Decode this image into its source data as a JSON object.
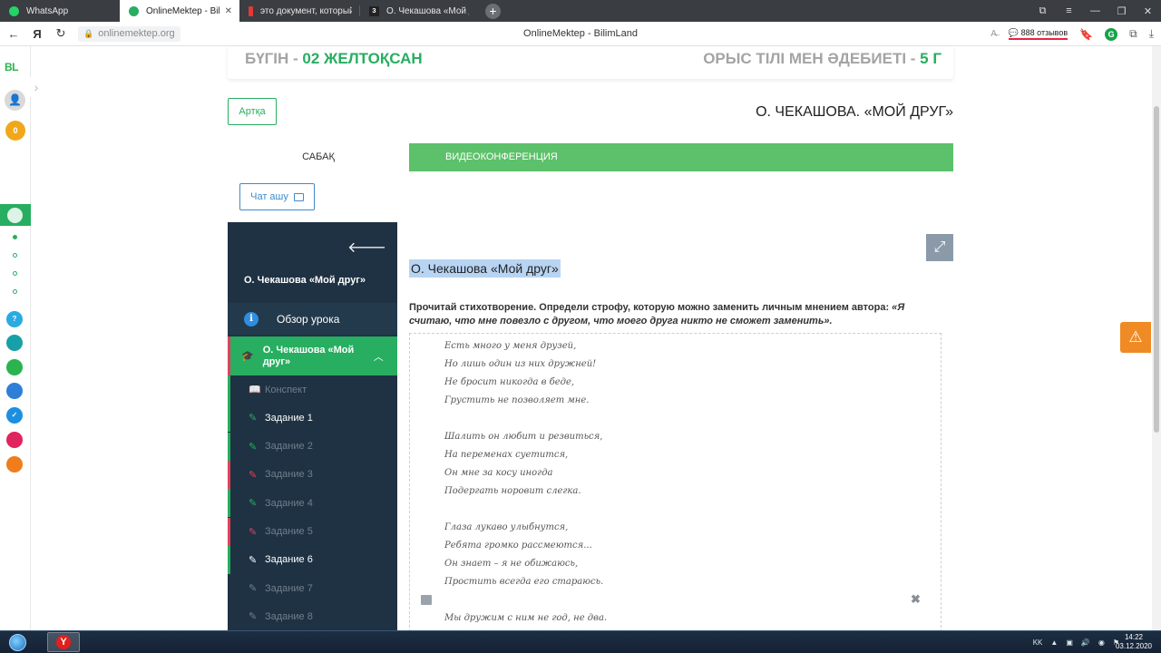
{
  "browser": {
    "tabs": [
      {
        "label": "WhatsApp",
        "icon": "whatsapp-icon",
        "color": "#25d366"
      },
      {
        "label": "OnlineMektep - BilimLa",
        "icon": "bilimland-icon",
        "color": "#27ae60",
        "active": true
      },
      {
        "label": "это документ, который со",
        "icon": "document-icon",
        "color": "#e53935"
      },
      {
        "label": "О. Чекашова «Мой друг»",
        "icon": "page-icon",
        "color": "#333333"
      }
    ],
    "new_tab": "+",
    "url": "onlinemektep.org",
    "page_title": "OnlineMektep - BilimLand",
    "reviews": "888 отзывов"
  },
  "rail": {
    "logo": "BL",
    "coins": "0"
  },
  "header": {
    "today_label": "БҮГІН - ",
    "date": "02 ЖЕЛТОҚСАН",
    "subject": "ОРЫС ТІЛІ МЕН ӘДЕБИЕТІ - ",
    "grade": "5 Г"
  },
  "back_label": "Артқа",
  "lesson_title": "О. ЧЕКАШОВА. «МОЙ ДРУГ»",
  "tabs": {
    "lesson": "САБАҚ",
    "video": "ВИДЕОКОНФЕРЕНЦИЯ"
  },
  "chat_label": "Чат ашу",
  "sidebar": {
    "title": "О. Чекашова «Мой друг»",
    "overview": "Обзор урока",
    "current": "О. Чекашова «Мой друг»",
    "items": [
      {
        "label": "Конспект",
        "icon": "book-open-icon",
        "state": "dim",
        "color": "#27ae60"
      },
      {
        "label": "Задание 1",
        "icon": "edit-icon",
        "state": "active",
        "color": "#27ae60"
      },
      {
        "label": "Задание 2",
        "icon": "edit-icon",
        "state": "dim",
        "color": "#27ae60"
      },
      {
        "label": "Задание 3",
        "icon": "edit-icon",
        "state": "dim",
        "color": "#e0415e"
      },
      {
        "label": "Задание 4",
        "icon": "edit-icon",
        "state": "dim",
        "color": "#27ae60"
      },
      {
        "label": "Задание 5",
        "icon": "edit-icon",
        "state": "dim",
        "color": "#e0415e"
      },
      {
        "label": "Задание 6",
        "icon": "edit-icon",
        "state": "active",
        "color": "#ffffff"
      },
      {
        "label": "Задание 7",
        "icon": "edit-icon",
        "state": "dim",
        "color": "#6f7e8c"
      },
      {
        "label": "Задание 8",
        "icon": "edit-icon",
        "state": "dim",
        "color": "#6f7e8c"
      }
    ]
  },
  "task": {
    "title": "О. Чекашова «Мой друг»",
    "instruction": "Прочитай стихотворение. Определи строфу, которую можно заменить личным мнением автора: ",
    "quote": "«Я считаю, что мне повезло с другом, что моего друга никто не сможет заменить».",
    "poem": [
      "Есть много у меня друзей,",
      "Но лишь один из них дружней!",
      "Не бросит никогда в беде,",
      "Грустить не позволяет мне.",
      "",
      "Шалить он любит и резвиться,",
      "На переменах суетится,",
      "Он мне за косу иногда",
      "Подергать норовит слегка.",
      "",
      "Глаза лукаво улыбнутся,",
      "Ребята громко рассмеются...",
      "Он знает – я не обижаюсь,",
      "Простить всегда его стараюсь.",
      "",
      "Мы дружим с ним не год, не два."
    ]
  },
  "taskbar": {
    "lang": "KK",
    "time": "14:22",
    "date": "03.12.2020"
  }
}
